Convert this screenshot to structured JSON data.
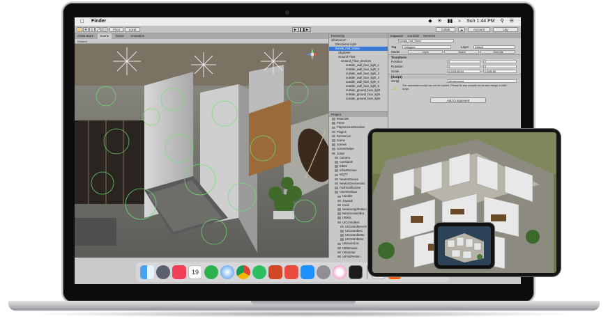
{
  "mac_menubar": {
    "app_name": "Finder",
    "clock": "Sun 1:44 PM"
  },
  "unity_toolbar": {
    "pivot_label": "Pivot",
    "local_label": "Local",
    "collab_label": "Collab",
    "account_label": "Account",
    "layers_label": "Lay"
  },
  "scene_tabs": [
    "Asset Store",
    "Scene",
    "Game",
    "Animation"
  ],
  "scene_sub_label": "Shaded",
  "hierarchy": {
    "title": "Hierarchy",
    "rows": [
      "infraScene*",
      "Directional Light",
      "Kerala_Full_Home",
      "Skydome",
      "Ground Floor",
      "Ground_Floor_Devices",
      "outside_wall_face_light_1",
      "outside_wall_face_light_2",
      "outside_wall_face_light_3",
      "outside_wall_face_light_4",
      "outside_wall_face_light_5",
      "outside_wall_face_light_6",
      "outside_ground_face_light",
      "outside_ground_face_light",
      "outside_ground_face_light"
    ]
  },
  "project": {
    "title": "Project",
    "rows": [
      "Materials",
      "Parse",
      "PlayServicesResolver",
      "Plugins",
      "Resources",
      "Scene",
      "Scenes",
      "ScreenSwipe",
      "Script",
      "Camera",
      "Constants",
      "Editor",
      "Infrastructure",
      "MQTT",
      "NewtonDevice",
      "NewtonDeviceAnim",
      "PushNotification",
      "UserInterface",
      "Handler",
      "Joystick",
      "Knob",
      "NewtonApplication",
      "NewtonAssetBut",
      "UIBots",
      "UIControllers",
      "UIControllerArch",
      "UIControllerC",
      "UIControllerBo",
      "UIControllerM",
      "UIDeviceList",
      "UIElements",
      "UIExterior",
      "UIFirstPerson",
      "UIHome"
    ]
  },
  "inspector": {
    "tabs": [
      "Inspector",
      "Console",
      "Services"
    ],
    "object_name": "Kerala_Full_Home",
    "tag_label": "Tag",
    "tag_value": "Untagged",
    "layer_label": "Layer",
    "layer_value": "Default",
    "model_label": "Model",
    "model_buttons": [
      "Open",
      "Select",
      "Override"
    ],
    "transform_title": "Transform",
    "position_label": "Position",
    "rotation_label": "Rotation",
    "scale_label": "Scale",
    "pos_x": "0",
    "pos_y": "0",
    "rot_x": "0",
    "rot_y": "0",
    "scale_x": "0.008168134",
    "scale_y": "0.008168",
    "script_title": "(Script)",
    "script_label": "Script",
    "script_value": "Infrastructure",
    "warning_text": "The associated script can not be loaded. Please fix any compile errors and assign a valid script.",
    "add_component": "Add Component"
  },
  "dock_icons": [
    "finder-icon",
    "launchpad-icon",
    "pocket-icon",
    "calendar-icon",
    "feedly-icon",
    "safari-icon",
    "chrome-icon",
    "evernote-icon",
    "powerpoint-icon",
    "xmind-icon",
    "app-store-icon",
    "system-preferences-icon",
    "itunes-icon",
    "terminal-icon",
    "preview-icon",
    "vlc-icon"
  ],
  "dock_calendar_day": "19",
  "colors": {
    "unity_panel": "#c8c8c8",
    "selection": "#3c78d8",
    "gizmo_green": "#6ee06e"
  }
}
